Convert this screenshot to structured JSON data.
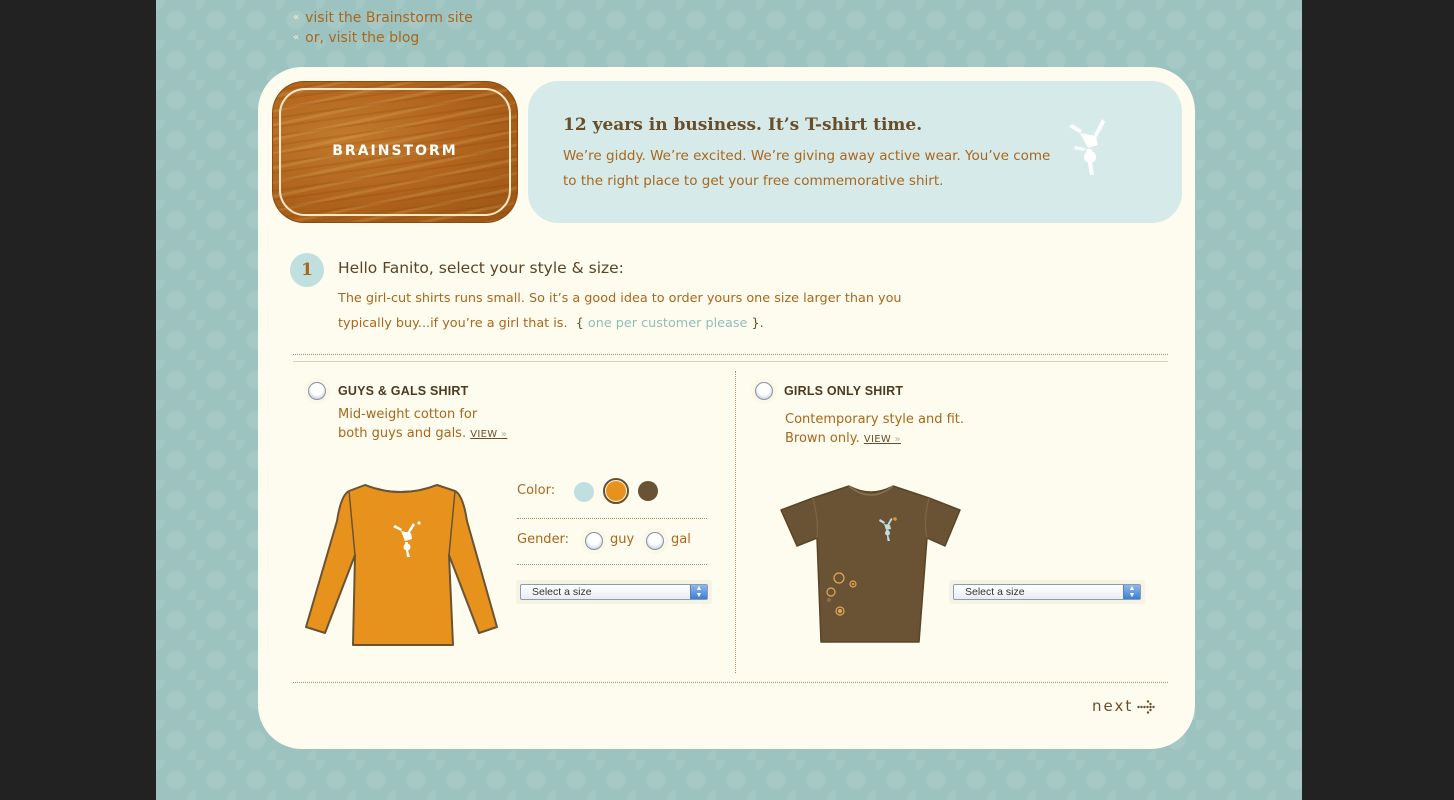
{
  "top_links": [
    {
      "label": "visit the Brainstorm site"
    },
    {
      "label": "or, visit the blog"
    }
  ],
  "logo": {
    "text": "BRAINSTORM"
  },
  "hero": {
    "title": "12 years in business. It’s T-shirt time.",
    "body": "We’re giddy. We’re excited. We’re giving away active wear. You’ve come to the right place to get your free commemorative shirt.",
    "icon": "handstand-figure-icon"
  },
  "step": {
    "number": "1",
    "title": "Hello Fanito, select your style & size:",
    "desc_main": "The girl-cut shirts runs small. So it’s a good idea to order yours one size larger than you typically buy...if you’re a girl that is.",
    "brace_open": "{",
    "desc_note": "one per customer please",
    "brace_close": "}."
  },
  "options": {
    "guys_gals": {
      "title": "GUYS & GALS SHIRT",
      "desc_line1": "Mid-weight cotton for",
      "desc_line2": "both guys and gals.",
      "view": "VIEW",
      "view_arrow": "»",
      "color_label": "Color:",
      "colors": [
        "#bfe0de",
        "#e8921e",
        "#6a5334"
      ],
      "selected_color": "#e8921e",
      "gender_label": "Gender:",
      "gender_options": [
        "guy",
        "gal"
      ],
      "size_select": "Select a size"
    },
    "girls_only": {
      "title": "GIRLS ONLY SHIRT",
      "desc_line1": "Contemporary style and fit.",
      "desc_line2": "Brown only.",
      "view": "VIEW",
      "view_arrow": "»",
      "size_select": "Select a size"
    }
  },
  "next": {
    "label": "next"
  },
  "top_link_chevron": "«"
}
